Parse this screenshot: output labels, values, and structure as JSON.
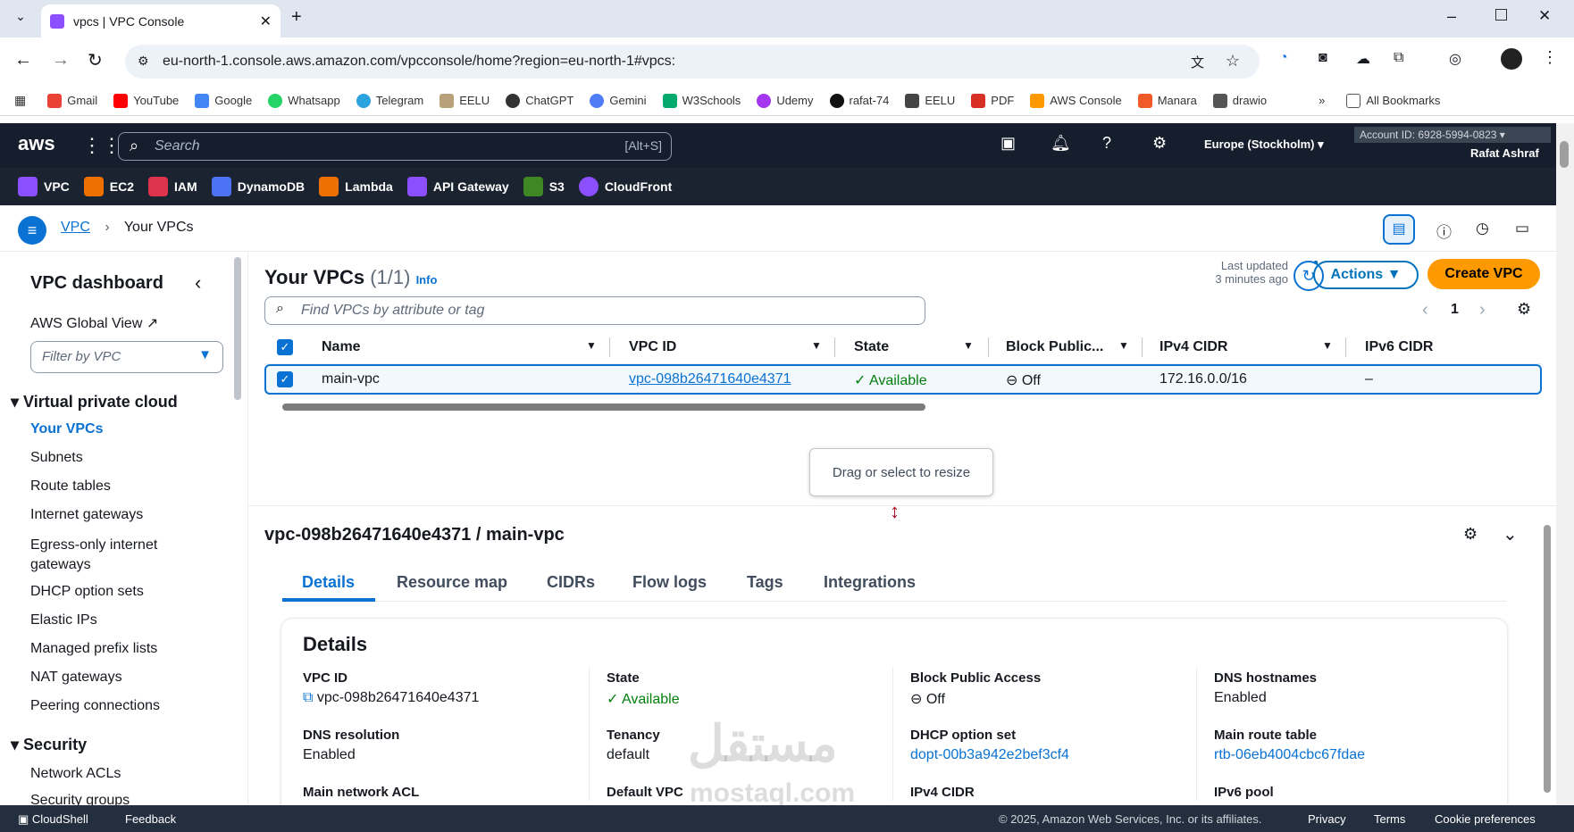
{
  "browser": {
    "tab_title": "vpcs | VPC Console",
    "url": "eu-north-1.console.aws.amazon.com/vpcconsole/home?region=eu-north-1#vpcs:",
    "bookmarks": [
      "Gmail",
      "YouTube",
      "Google",
      "Whatsapp",
      "Telegram",
      "EELU",
      "ChatGPT",
      "Gemini",
      "W3Schools",
      "Udemy",
      "rafat-74",
      "EELU",
      "PDF",
      "AWS Console",
      "Manara",
      "drawio"
    ],
    "all_bookmarks": "All Bookmarks"
  },
  "aws": {
    "logo": "aws",
    "search_placeholder": "Search",
    "search_shortcut": "[Alt+S]",
    "region": "Europe (Stockholm)",
    "account": "Account ID: 6928-5994-0823",
    "user": "Rafat Ashraf",
    "services": [
      "VPC",
      "EC2",
      "IAM",
      "DynamoDB",
      "Lambda",
      "API Gateway",
      "S3",
      "CloudFront"
    ],
    "service_colors": [
      "#8c4fff",
      "#ed7100",
      "#dd344c",
      "#4d72f3",
      "#ed7100",
      "#8c4fff",
      "#3f8624",
      "#8c4fff"
    ]
  },
  "breadcrumb": {
    "root": "VPC",
    "current": "Your VPCs"
  },
  "sidebar": {
    "title": "VPC dashboard",
    "global_view": "AWS Global View",
    "filter_placeholder": "Filter by VPC",
    "section_vpc": "Virtual private cloud",
    "items": [
      "Your VPCs",
      "Subnets",
      "Route tables",
      "Internet gateways",
      "Egress-only internet gateways",
      "DHCP option sets",
      "Elastic IPs",
      "Managed prefix lists",
      "NAT gateways",
      "Peering connections"
    ],
    "section_security": "Security",
    "security_items": [
      "Network ACLs",
      "Security groups"
    ]
  },
  "main": {
    "title": "Your VPCs",
    "count": "(1/1)",
    "info": "Info",
    "last_updated": "Last updated",
    "last_updated_ago": "3 minutes ago",
    "actions": "Actions",
    "create": "Create VPC",
    "find_placeholder": "Find VPCs by attribute or tag",
    "page": "1",
    "columns": [
      "Name",
      "VPC ID",
      "State",
      "Block Public...",
      "IPv4 CIDR",
      "IPv6 CIDR"
    ],
    "row": {
      "name": "main-vpc",
      "vpc_id": "vpc-098b26471640e4371",
      "state": "Available",
      "block": "Off",
      "ipv4": "172.16.0.0/16",
      "ipv6": "–"
    },
    "tooltip": "Drag or select to resize"
  },
  "detail": {
    "heading": "vpc-098b26471640e4371 / main-vpc",
    "tabs": [
      "Details",
      "Resource map",
      "CIDRs",
      "Flow logs",
      "Tags",
      "Integrations"
    ],
    "section": "Details",
    "fields": [
      {
        "label": "VPC ID",
        "value": "vpc-098b26471640e4371"
      },
      {
        "label": "State",
        "value": "Available"
      },
      {
        "label": "Block Public Access",
        "value": "Off"
      },
      {
        "label": "DNS hostnames",
        "value": "Enabled"
      },
      {
        "label": "DNS resolution",
        "value": "Enabled"
      },
      {
        "label": "Tenancy",
        "value": "default"
      },
      {
        "label": "DHCP option set",
        "value": "dopt-00b3a942e2bef3cf4"
      },
      {
        "label": "Main route table",
        "value": "rtb-06eb4004cbc67fdae"
      },
      {
        "label": "Main network ACL",
        "value": ""
      },
      {
        "label": "Default VPC",
        "value": ""
      },
      {
        "label": "IPv4 CIDR",
        "value": ""
      },
      {
        "label": "IPv6 pool",
        "value": ""
      }
    ],
    "watermark_ar": "مستقل",
    "watermark": "mostaql.com"
  },
  "footer": {
    "cloudshell": "CloudShell",
    "feedback": "Feedback",
    "copyright": "© 2025, Amazon Web Services, Inc. or its affiliates.",
    "privacy": "Privacy",
    "terms": "Terms",
    "cookies": "Cookie preferences"
  }
}
